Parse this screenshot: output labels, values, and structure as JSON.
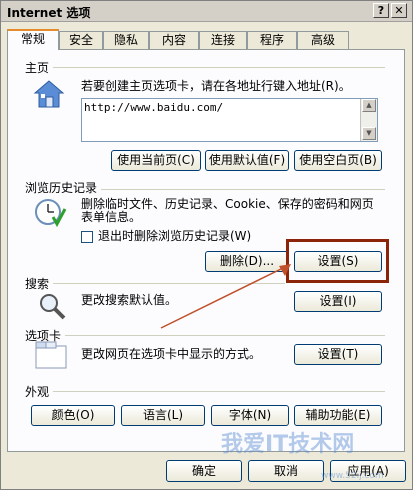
{
  "window": {
    "title": "Internet 选项",
    "help_label": "?",
    "close_label": "✕"
  },
  "tabs": [
    {
      "label": "常规",
      "active": true
    },
    {
      "label": "安全"
    },
    {
      "label": "隐私"
    },
    {
      "label": "内容"
    },
    {
      "label": "连接"
    },
    {
      "label": "程序"
    },
    {
      "label": "高级"
    }
  ],
  "home": {
    "section_label": "主页",
    "description": "若要创建主页选项卡，请在各地址行键入地址(R)。",
    "url": "http://www.baidu.com/",
    "buttons": [
      "使用当前页(C)",
      "使用默认值(F)",
      "使用空白页(B)"
    ]
  },
  "history": {
    "section_label": "浏览历史记录",
    "description_line1": "删除临时文件、历史记录、Cookie、保存的密码和网页",
    "description_line2": "表单信息。",
    "checkbox_label": "退出时删除浏览历史记录(W)",
    "delete_button": "删除(D)...",
    "settings_button": "设置(S)"
  },
  "search": {
    "section_label": "搜索",
    "description": "更改搜索默认值。",
    "settings_button": "设置(I)"
  },
  "tabs_section": {
    "section_label": "选项卡",
    "description": "更改网页在选项卡中显示的方式。",
    "settings_button": "设置(T)"
  },
  "appearance": {
    "section_label": "外观",
    "buttons": [
      "颜色(O)",
      "语言(L)",
      "字体(N)",
      "辅助功能(E)"
    ]
  },
  "dialog": {
    "ok": "确定",
    "cancel": "取消",
    "apply": "应用(A)"
  },
  "watermark": {
    "text": "我爱IT技术网",
    "sub": "www.52ij.com"
  },
  "colors": {
    "highlight_border": "#8b2408",
    "annotation_arrow": "#c0502a"
  }
}
